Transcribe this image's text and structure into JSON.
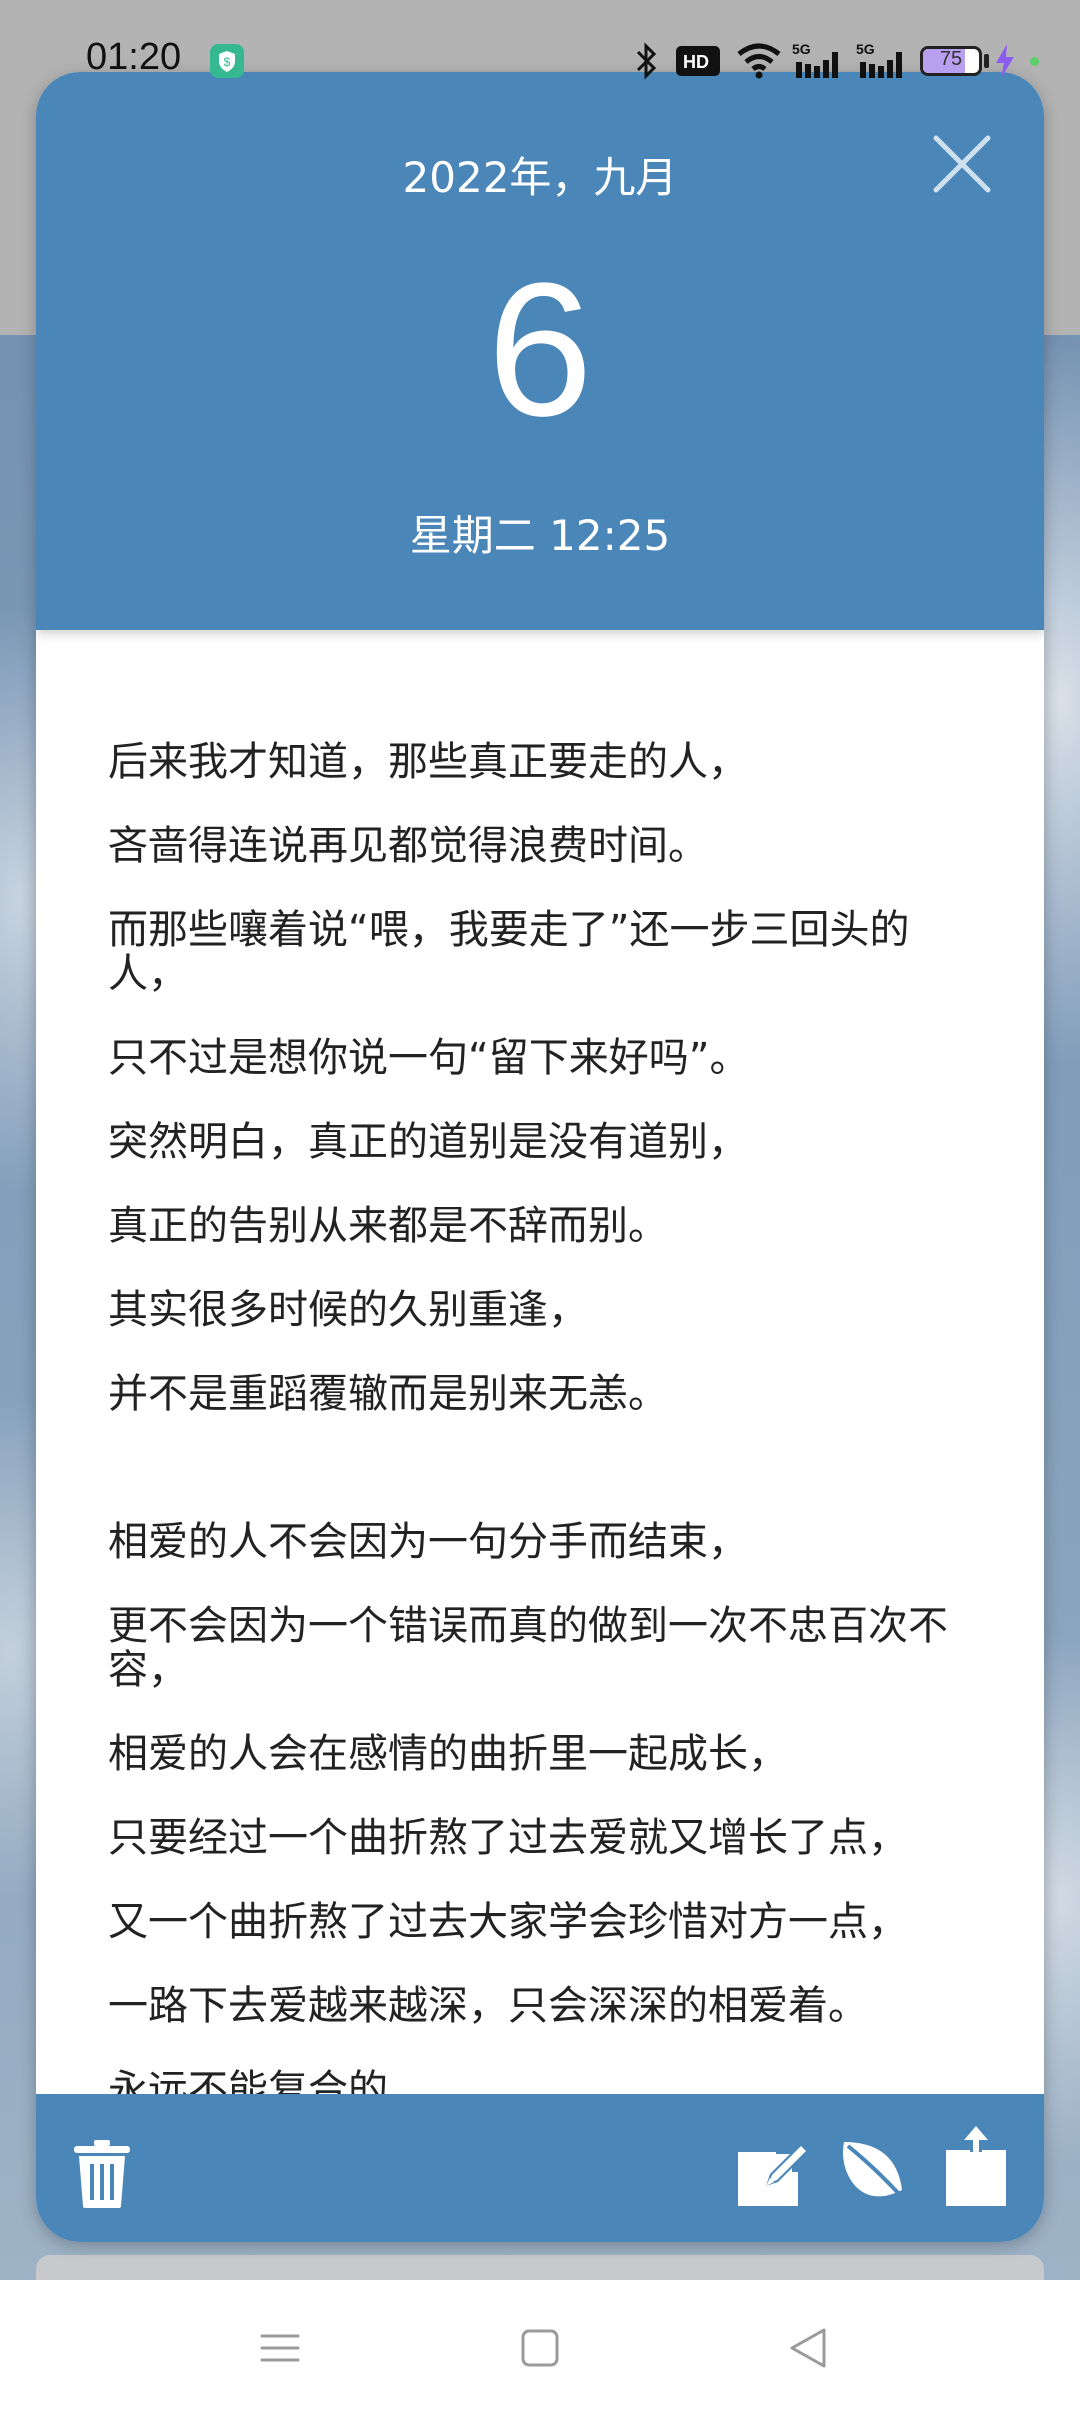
{
  "status_bar": {
    "time": "01:20",
    "battery": "75",
    "battery_level": 0.75,
    "icons": [
      "shield-icon",
      "bluetooth-icon",
      "hd-icon",
      "wifi-icon",
      "signal-5g-icon",
      "signal-5g-icon",
      "battery-icon",
      "charging-icon"
    ]
  },
  "header": {
    "month_year": "2022年，九月",
    "day": "6",
    "weekday_time": "星期二 12:25"
  },
  "body": {
    "paragraph_1": [
      "后来我才知道，那些真正要走的人，",
      "吝啬得连说再见都觉得浪费时间。",
      "而那些嚷着说“喂，我要走了”还一步三回头的人，",
      "只不过是想你说一句“留下来好吗”。",
      "突然明白，真正的道别是没有道别，",
      "真正的告别从来都是不辞而别。",
      "其实很多时候的久别重逢，",
      "并不是重蹈覆辙而是别来无恙。"
    ],
    "paragraph_2": [
      "相爱的人不会因为一句分手而结束，",
      "更不会因为一个错误而真的做到一次不忠百次不容，",
      "相爱的人会在感情的曲折里一起成长，",
      "只要经过一个曲折熬了过去爱就又增长了点，",
      "又一个曲折熬了过去大家学会珍惜对方一点，",
      "一路下去爱越来越深，只会深深的相爱着。",
      "永远不能复合的，"
    ]
  },
  "colors": {
    "accent": "#4a86b8",
    "body_text": "#222222"
  }
}
